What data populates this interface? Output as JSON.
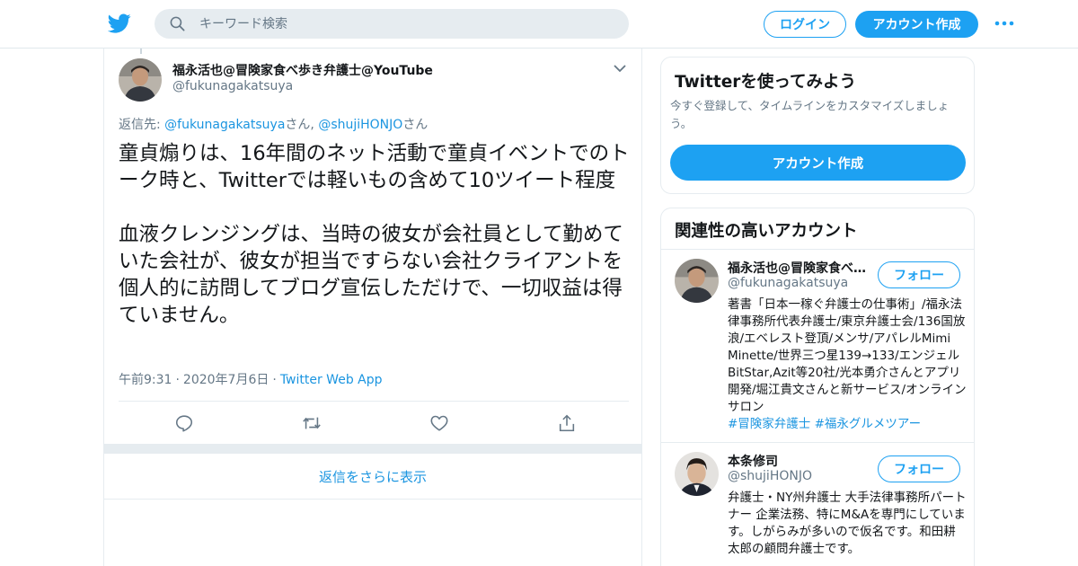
{
  "search": {
    "placeholder": "キーワード検索"
  },
  "header": {
    "login_label": "ログイン",
    "signup_label": "アカウント作成"
  },
  "tweet": {
    "author_name": "福永活也@冒険家食べ歩き弁護士@YouTube",
    "author_handle": "@fukunagakatsuya",
    "reply_prefix": "返信先: ",
    "reply_user1": "@fukunagakatsuya",
    "reply_suffix1": "さん, ",
    "reply_user2": "@shujiHONJO",
    "reply_suffix2": "さん",
    "paragraph1": "童貞煽りは、16年間のネット活動で童貞イベントでのトーク時と、Twitterでは軽いもの含めて10ツイート程度",
    "paragraph2": "血液クレンジングは、当時の彼女が会社員として勤めていた会社が、彼女が担当ですらない会社クライアントを個人的に訪問してブログ宣伝しただけで、一切収益は得ていません。",
    "time": "午前9:31",
    "date": "2020年7月6日",
    "separator": "·",
    "source": "Twitter Web App"
  },
  "thread": {
    "show_more_label": "返信をさらに表示"
  },
  "signup_card": {
    "title": "Twitterを使ってみよう",
    "description": "今すぐ登録して、タイムラインをカスタマイズしましょう。",
    "button_label": "アカウント作成"
  },
  "related": {
    "title": "関連性の高いアカウント",
    "accounts": [
      {
        "name": "福永活也@冒険家食べ歩き弁護士@YouTube",
        "handle": "@fukunagakatsuya",
        "follow_label": "フォロー",
        "bio": "著書「日本一稼ぐ弁護士の仕事術」/福永法律事務所代表弁護士/東京弁護士会/136国放浪/エベレスト登頂/メンサ/アパレルMimi Minette/世界三つ星139→133/エンジェルBitStar,Azit等20社/光本勇介さんとアプリ開発/堀江貴文さんと新サービス/オンラインサロン",
        "tag1": "#冒険家弁護士",
        "tag2": "#福永グルメツアー"
      },
      {
        "name": "本条修司",
        "handle": "@shujiHONJO",
        "follow_label": "フォロー",
        "bio": "弁護士・NY州弁護士 大手法律事務所パートナー 企業法務、特にM&Aを専門にしています。しがらみが多いので仮名です。和田耕太郎の顧問弁護士です。"
      }
    ]
  },
  "colors": {
    "brand_blue": "#1da1f2",
    "link_blue": "#1b95e0",
    "secondary_gray": "#657786",
    "border": "#e6ecf0"
  }
}
